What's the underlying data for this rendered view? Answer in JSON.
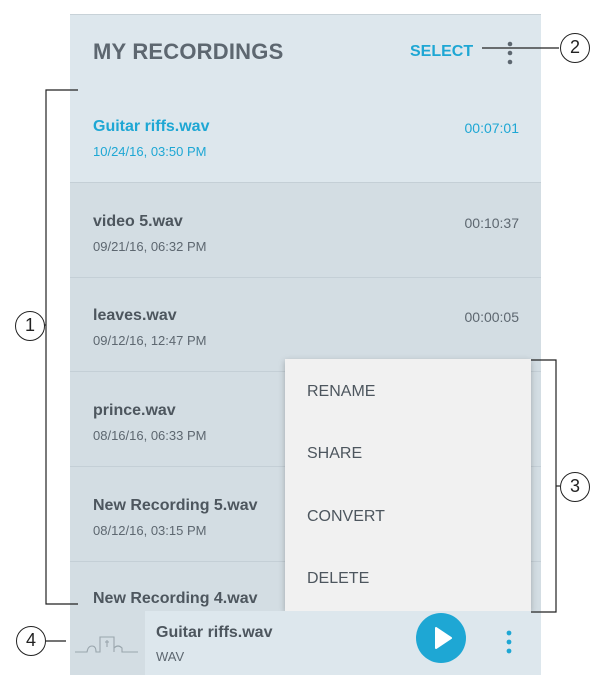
{
  "header": {
    "title": "MY RECORDINGS",
    "select_label": "SELECT"
  },
  "recordings": [
    {
      "name": "Guitar riffs.wav",
      "date": "10/24/16, 03:50 PM",
      "duration": "00:07:01",
      "active": true
    },
    {
      "name": "video 5.wav",
      "date": "09/21/16, 06:32 PM",
      "duration": "00:10:37"
    },
    {
      "name": "leaves.wav",
      "date": "09/12/16, 12:47 PM",
      "duration": "00:00:05"
    },
    {
      "name": "prince.wav",
      "date": "08/16/16, 06:33 PM",
      "duration": ""
    },
    {
      "name": "New Recording 5.wav",
      "date": "08/12/16, 03:15 PM",
      "duration": ""
    },
    {
      "name": "New Recording 4.wav",
      "date": "",
      "duration": ""
    }
  ],
  "context_menu": {
    "items": [
      "RENAME",
      "SHARE",
      "CONVERT",
      "DELETE"
    ]
  },
  "player": {
    "title": "Guitar riffs.wav",
    "format": "WAV"
  },
  "callouts": [
    "1",
    "2",
    "3",
    "4"
  ],
  "colors": {
    "accent": "#1ea7d4",
    "list_background": "#d3dde3",
    "header_background": "#dde7ed",
    "menu_background": "#f1f1f1"
  },
  "icons": {
    "header_more": "more-vert-icon",
    "play": "play-icon",
    "player_more": "more-vert-icon",
    "thumbnail": "guitar-thumbnail-icon"
  }
}
